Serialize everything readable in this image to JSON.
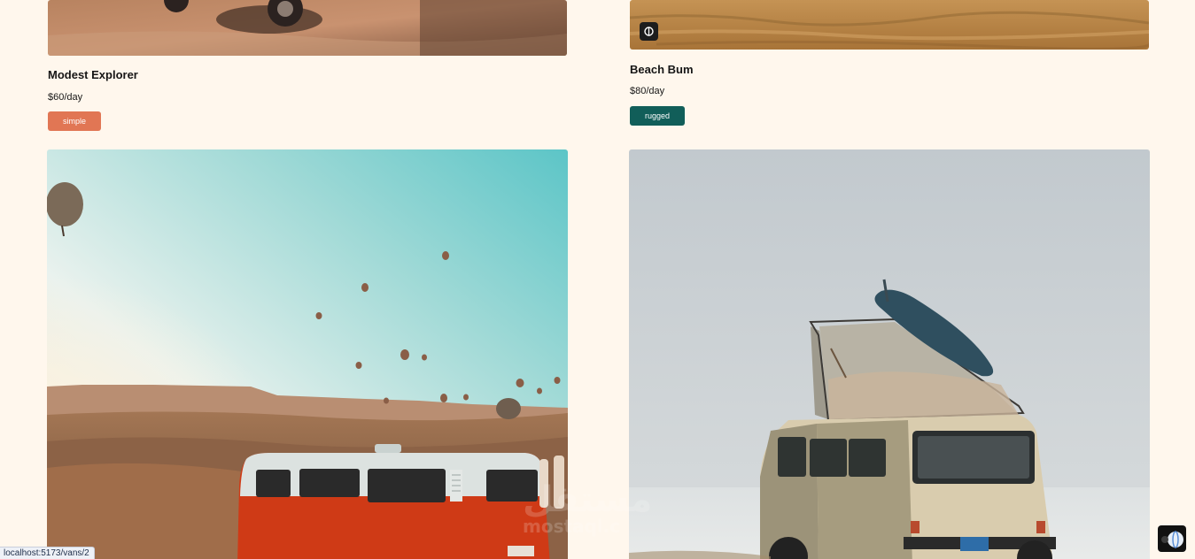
{
  "vans": [
    {
      "name": "Modest Explorer",
      "price": "$60/day",
      "type": "simple",
      "type_color": "#E17654"
    },
    {
      "name": "Beach Bum",
      "price": "$80/day",
      "type": "rugged",
      "type_color": "#115E59"
    },
    {
      "image": "red-van-hot-air-balloons"
    },
    {
      "image": "beige-van-surfboard-popup-roof"
    }
  ],
  "status_bar": {
    "url": "localhost:5173/vans/2"
  },
  "watermark": {
    "arabic": "مستقل",
    "latin": "mostaql.c"
  },
  "colors": {
    "page_background": "#FFF7ED",
    "simple": "#E17654",
    "rugged": "#115E59"
  }
}
